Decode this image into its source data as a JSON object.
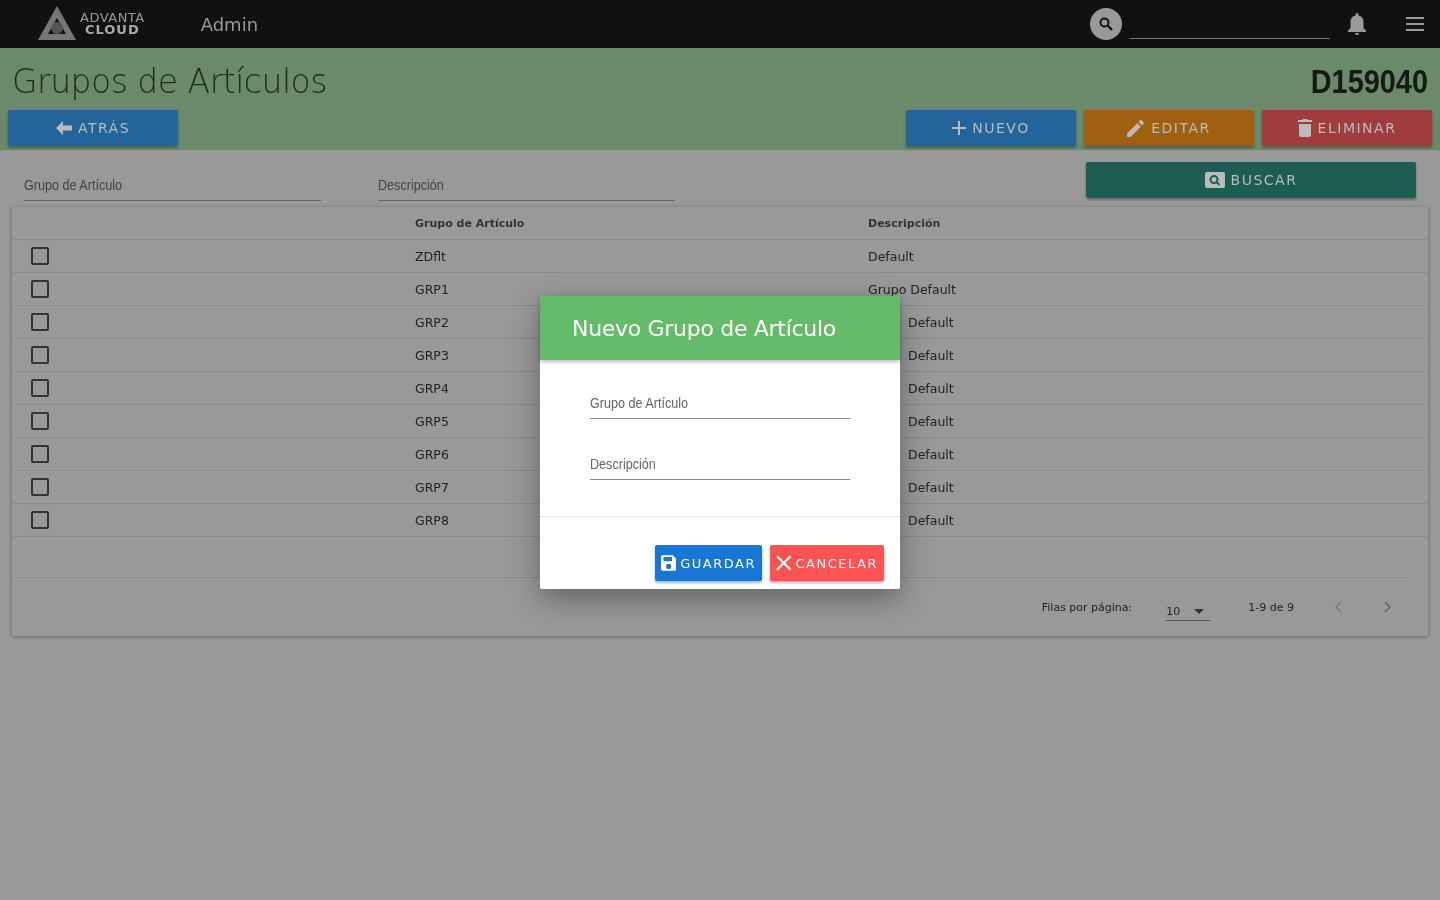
{
  "header": {
    "brand": [
      "ADVANTA",
      "CLOUD"
    ],
    "section": "Admin"
  },
  "page": {
    "title": "Grupos de Artículos",
    "code": "D159040"
  },
  "actions": [
    {
      "kind": "back",
      "label": "ATRÁS"
    },
    {
      "kind": "new",
      "label": "NUEVO"
    },
    {
      "kind": "edit",
      "label": "EDITAR"
    },
    {
      "kind": "delete",
      "label": "ELIMINAR"
    }
  ],
  "filters": {
    "fields": [
      {
        "placeholder": "Grupo de Artículo"
      },
      {
        "placeholder": "Descripción"
      }
    ],
    "search_button": "BUSCAR"
  },
  "table": {
    "columns": [
      "Grupo de Artículo",
      "Descripción"
    ],
    "rows": [
      {
        "checked": false,
        "cells": [
          "ZDflt",
          "Default"
        ]
      },
      {
        "checked": false,
        "cells": [
          "GRP1",
          "Grupo Default"
        ]
      },
      {
        "checked": false,
        "cells": [
          "GRP2",
          {
            "text": "Default",
            "clipped": true
          }
        ]
      },
      {
        "checked": false,
        "cells": [
          "GRP3",
          {
            "text": "Default",
            "clipped": true
          }
        ]
      },
      {
        "checked": false,
        "cells": [
          "GRP4",
          {
            "text": "Default",
            "clipped": true
          }
        ]
      },
      {
        "checked": false,
        "cells": [
          "GRP5",
          {
            "text": "Default",
            "clipped": true
          }
        ]
      },
      {
        "checked": false,
        "cells": [
          "GRP6",
          {
            "text": "Default",
            "clipped": true
          }
        ]
      },
      {
        "checked": false,
        "cells": [
          "GRP7",
          {
            "text": "Default",
            "clipped": true
          }
        ]
      },
      {
        "checked": false,
        "cells": [
          "GRP8",
          {
            "text": "Default",
            "clipped": true
          }
        ]
      }
    ],
    "pagination": {
      "rows_label": "Filas por página:",
      "rows_per_page": "10",
      "range": "1-9 de 9"
    }
  },
  "dialog": {
    "title": "Nuevo Grupo de Artículo",
    "fields": [
      {
        "placeholder": "Grupo de Artículo"
      },
      {
        "placeholder": "Descripción"
      }
    ],
    "buttons": [
      {
        "kind": "save",
        "label": "GUARDAR"
      },
      {
        "kind": "cancel",
        "label": "CANCELAR"
      }
    ]
  }
}
